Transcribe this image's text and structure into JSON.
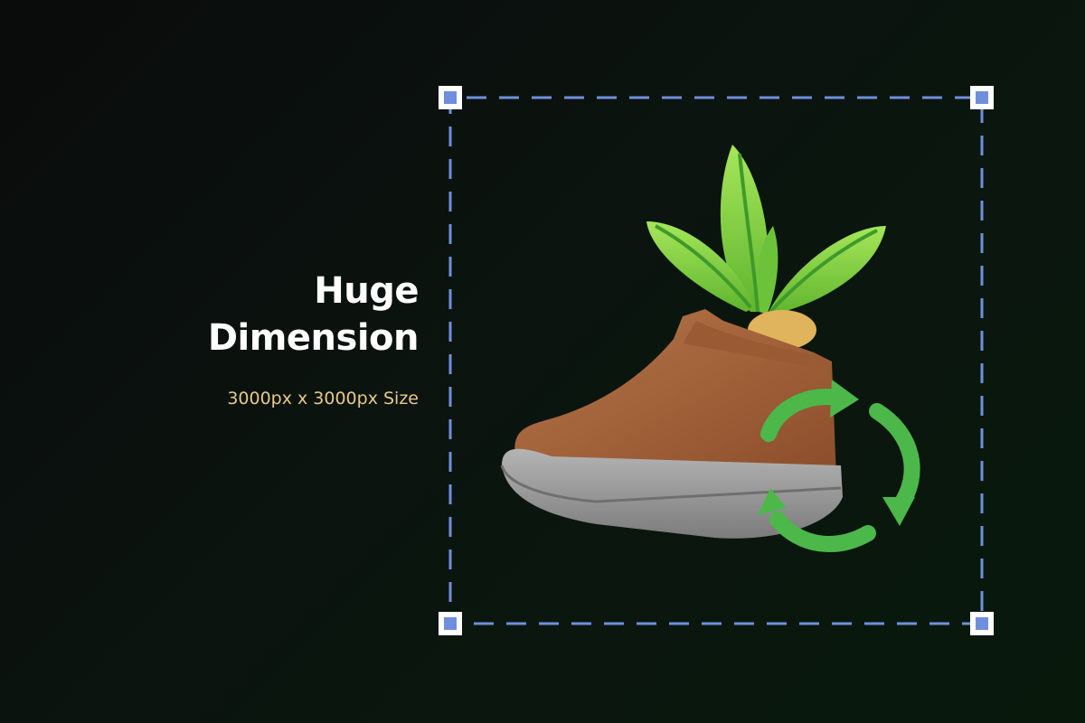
{
  "heading": {
    "line1": "Huge",
    "line2": "Dimension"
  },
  "subtitle": "3000px x 3000px Size",
  "colors": {
    "background": "#0a0f0c",
    "heading": "#ffffff",
    "subtitle": "#e7c98a",
    "frame_dash": "#6f8fdc",
    "handle_fill": "#ffffff",
    "boot": "#a8643c",
    "sole": "#9a9a9a",
    "leaf": "#7fd13b",
    "recycle_arrows": "#4cb84a"
  },
  "illustration": {
    "subject": "boot-planter-with-recycle-arrows",
    "icons": [
      "boot-icon",
      "plant-leaves-icon",
      "recycle-arrows-icon"
    ]
  }
}
